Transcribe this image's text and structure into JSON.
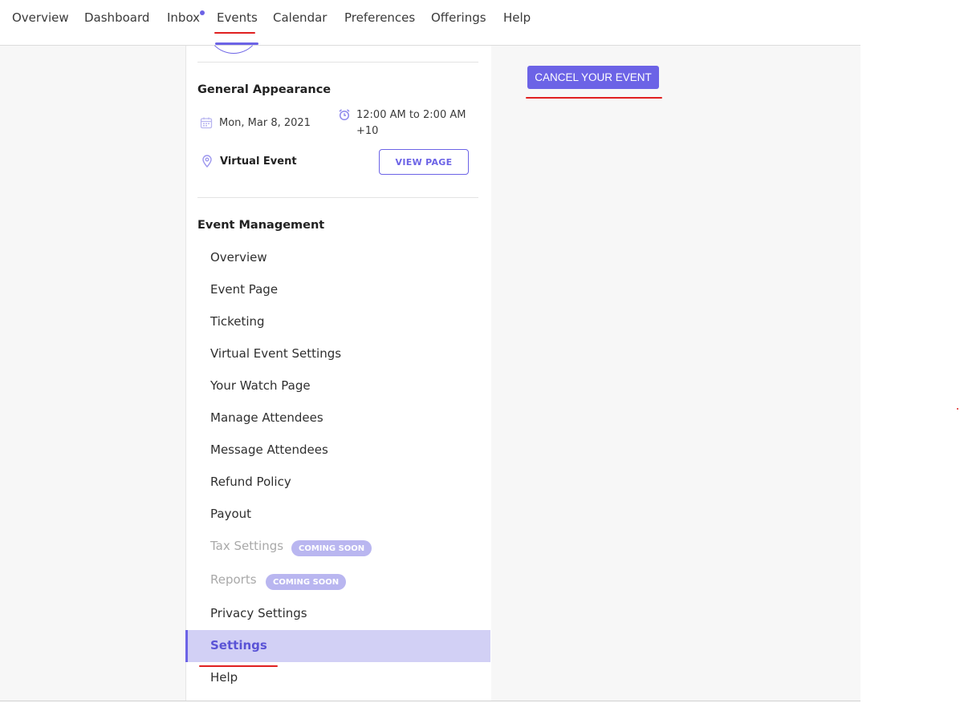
{
  "nav": {
    "items": [
      "Overview",
      "Dashboard",
      "Inbox",
      "Events",
      "Calendar",
      "Preferences",
      "Offerings",
      "Help"
    ],
    "active": "Events"
  },
  "event": {
    "appearance_title": "General Appearance",
    "date": "Mon, Mar 8, 2021",
    "time_line1": "12:00 AM to 2:00 AM",
    "time_line2": "+10",
    "location": "Virtual Event",
    "view_page_label": "VIEW PAGE"
  },
  "management": {
    "title": "Event Management",
    "items": [
      {
        "label": "Overview"
      },
      {
        "label": "Event Page"
      },
      {
        "label": "Ticketing"
      },
      {
        "label": "Virtual Event Settings"
      },
      {
        "label": "Your Watch Page"
      },
      {
        "label": "Manage Attendees"
      },
      {
        "label": "Message Attendees"
      },
      {
        "label": "Refund Policy"
      },
      {
        "label": "Payout"
      },
      {
        "label": "Tax Settings",
        "badge": "COMING SOON"
      },
      {
        "label": "Reports",
        "badge": "COMING SOON"
      },
      {
        "label": "Privacy Settings"
      },
      {
        "label": "Settings"
      },
      {
        "label": "Help"
      }
    ]
  },
  "main": {
    "cancel_label": "CANCEL YOUR EVENT"
  },
  "colors": {
    "accent": "#6c63e6",
    "active_bg": "#d2d0f5",
    "badge_bg": "#b9b6f0",
    "annotation_red": "#e02020"
  }
}
